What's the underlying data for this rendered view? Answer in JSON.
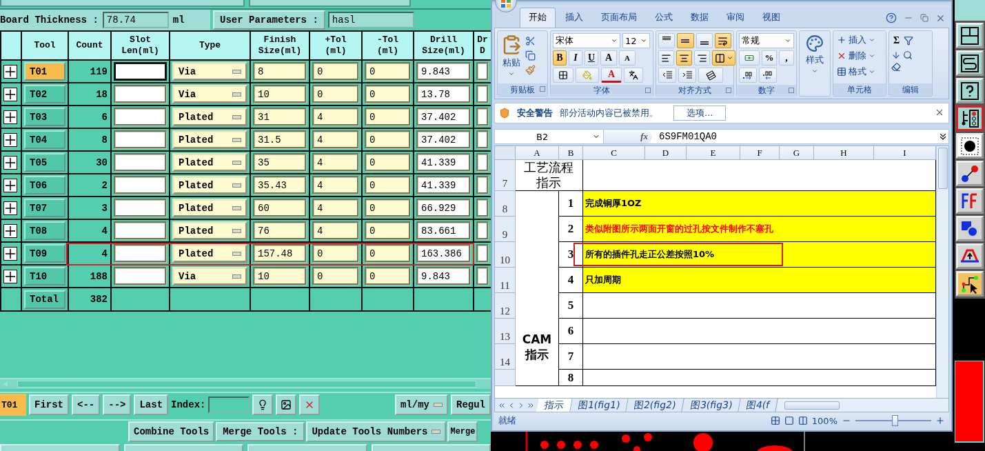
{
  "board": {
    "thickness_label": "Board Thickness :",
    "thickness": "78.74",
    "unit": "ml",
    "user_label": "User Parameters :",
    "user_value": "hasl"
  },
  "table": {
    "columns": [
      "",
      "Tool",
      "Count",
      "Slot\nLen(ml)",
      "Type",
      "Finish\nSize(ml)",
      "+Tol\n(ml)",
      "-Tol\n(ml)",
      "Drill\nSize(ml)",
      "Dr\nD"
    ],
    "rows": [
      {
        "tool": "T01",
        "count": "119",
        "type": "Via",
        "finish": "8",
        "ptol": "0",
        "ntol": "0",
        "drill": "9.843",
        "selected": true,
        "annotated": false
      },
      {
        "tool": "T02",
        "count": "18",
        "type": "Via",
        "finish": "10",
        "ptol": "0",
        "ntol": "0",
        "drill": "13.78",
        "selected": false,
        "annotated": false
      },
      {
        "tool": "T03",
        "count": "6",
        "type": "Plated",
        "finish": "31",
        "ptol": "4",
        "ntol": "0",
        "drill": "37.402",
        "selected": false,
        "annotated": false
      },
      {
        "tool": "T04",
        "count": "8",
        "type": "Plated",
        "finish": "31.5",
        "ptol": "4",
        "ntol": "0",
        "drill": "37.402",
        "selected": false,
        "annotated": false
      },
      {
        "tool": "T05",
        "count": "30",
        "type": "Plated",
        "finish": "35",
        "ptol": "4",
        "ntol": "0",
        "drill": "41.339",
        "selected": false,
        "annotated": false
      },
      {
        "tool": "T06",
        "count": "2",
        "type": "Plated",
        "finish": "35.43",
        "ptol": "4",
        "ntol": "0",
        "drill": "41.339",
        "selected": false,
        "annotated": false
      },
      {
        "tool": "T07",
        "count": "3",
        "type": "Plated",
        "finish": "60",
        "ptol": "4",
        "ntol": "0",
        "drill": "66.929",
        "selected": false,
        "annotated": false
      },
      {
        "tool": "T08",
        "count": "4",
        "type": "Plated",
        "finish": "76",
        "ptol": "4",
        "ntol": "0",
        "drill": "83.661",
        "selected": false,
        "annotated": false
      },
      {
        "tool": "T09",
        "count": "4",
        "type": "Plated",
        "finish": "157.48",
        "ptol": "0",
        "ntol": "0",
        "drill": "163.386",
        "selected": false,
        "annotated": true
      },
      {
        "tool": "T10",
        "count": "188",
        "type": "Via",
        "finish": "10",
        "ptol": "0",
        "ntol": "0",
        "drill": "9.843",
        "selected": false,
        "annotated": false
      }
    ],
    "total": {
      "label": "Total",
      "count": "382"
    }
  },
  "nav": {
    "current": "T01",
    "buttons": [
      "First",
      "<--",
      "-->",
      "Last"
    ],
    "index_label": "Index:",
    "unit": "ml/my",
    "regul": "Regul"
  },
  "actions": {
    "combine": "Combine Tools",
    "merge_label": "Merge Tools :",
    "update": "Update Tools Numbers",
    "merge": "Merge"
  },
  "excel": {
    "tabs": [
      {
        "label": "开始",
        "selected": true
      },
      {
        "label": "插入",
        "selected": false
      },
      {
        "label": "页面布局",
        "selected": false
      },
      {
        "label": "公式",
        "selected": false
      },
      {
        "label": "数据",
        "selected": false
      },
      {
        "label": "审阅",
        "selected": false
      },
      {
        "label": "视图",
        "selected": false
      }
    ],
    "ribbon": {
      "paste": "粘贴",
      "font": "宋体",
      "size": "12",
      "format": [
        {
          "label": "B",
          "selected": true
        },
        {
          "label": "I",
          "selected": false
        },
        {
          "label": "U",
          "selected": false
        }
      ],
      "grow": "A",
      "shrink": "A",
      "color_a": "A",
      "align": [
        {
          "kind": "top",
          "selected": false
        },
        {
          "kind": "middle",
          "selected": true
        },
        {
          "kind": "bottom",
          "selected": false
        },
        {
          "kind": "wrap",
          "selected": true
        },
        {
          "kind": "left",
          "selected": false
        },
        {
          "kind": "center",
          "selected": true
        },
        {
          "kind": "right",
          "selected": false
        },
        {
          "kind": "merge",
          "selected": true
        }
      ],
      "number_format": "常规",
      "percent": "%",
      "comma": ",",
      "styles": "样式",
      "cells": [
        "插入",
        "删除",
        "格式"
      ],
      "sigma": "Σ",
      "groups": [
        "剪贴板",
        "字体",
        "对齐方式",
        "数字",
        "单元格",
        "编辑"
      ]
    },
    "security": {
      "title": "安全警告",
      "message": "部分活动内容已被禁用。",
      "button": "选项..."
    },
    "formula": {
      "cell": "B2",
      "fx": "fx",
      "value": "6S9FM01QA0"
    },
    "columns": [
      "A",
      "B",
      "C",
      "D",
      "E",
      "F",
      "G",
      "H",
      "I"
    ],
    "header_row": {
      "num": "7",
      "label": "工艺流程指示"
    },
    "section_label": "CAM指示",
    "items": [
      {
        "num": "8",
        "item": "1",
        "text": "完成铜厚1OZ",
        "fill": true,
        "color": "#000000",
        "annotated": false
      },
      {
        "num": "9",
        "item": "2",
        "text": "类似附图所示两面开窗的过孔按文件制作不塞孔",
        "fill": true,
        "color": "#ff0000",
        "annotated": false
      },
      {
        "num": "10",
        "item": "3",
        "text": "所有的插件孔走正公差按照10%",
        "fill": true,
        "color": "#000000",
        "annotated": true
      },
      {
        "num": "11",
        "item": "4",
        "text": "只加周期",
        "fill": true,
        "color": "#000000",
        "annotated": false
      },
      {
        "num": "12",
        "item": "5",
        "fill": false,
        "annotated": false
      },
      {
        "num": "13",
        "item": "6",
        "fill": false,
        "annotated": false
      },
      {
        "num": "14",
        "item": "7",
        "fill": false,
        "annotated": false
      },
      {
        "item": "8",
        "fill": false,
        "annotated": false
      }
    ],
    "sheets": [
      {
        "label": "指示",
        "selected": true
      },
      {
        "label": "图1(fig1)",
        "selected": false
      },
      {
        "label": "图2(fig2)",
        "selected": false
      },
      {
        "label": "图3(fig3)",
        "selected": false
      },
      {
        "label": "图4(f",
        "selected": false
      }
    ],
    "status": "就绪",
    "zoom": "100%",
    "zoom_slider": {
      "level": 0.52
    }
  },
  "toolbar": [
    {
      "kind": "layout",
      "color": "#9fd8d0",
      "selected": false
    },
    {
      "kind": "curve",
      "color": "#9fd8d0",
      "selected": false
    },
    {
      "kind": "help",
      "color": "#9fd8d0",
      "selected": false
    },
    {
      "kind": "layers",
      "color": "#9fd8d0",
      "selected": true
    },
    {
      "kind": "pad",
      "color": "#ffffff",
      "selected": false
    },
    {
      "kind": "connect",
      "color": "#d4d4d4",
      "selected": false
    },
    {
      "kind": "mirror",
      "color": "#d4d4d4",
      "selected": false
    },
    {
      "kind": "shapes",
      "color": "#d4d4d4",
      "selected": false
    },
    {
      "kind": "bridge",
      "color": "#d4d4d4",
      "selected": false
    },
    {
      "kind": "route",
      "color": "#f5c262",
      "selected": false
    }
  ]
}
